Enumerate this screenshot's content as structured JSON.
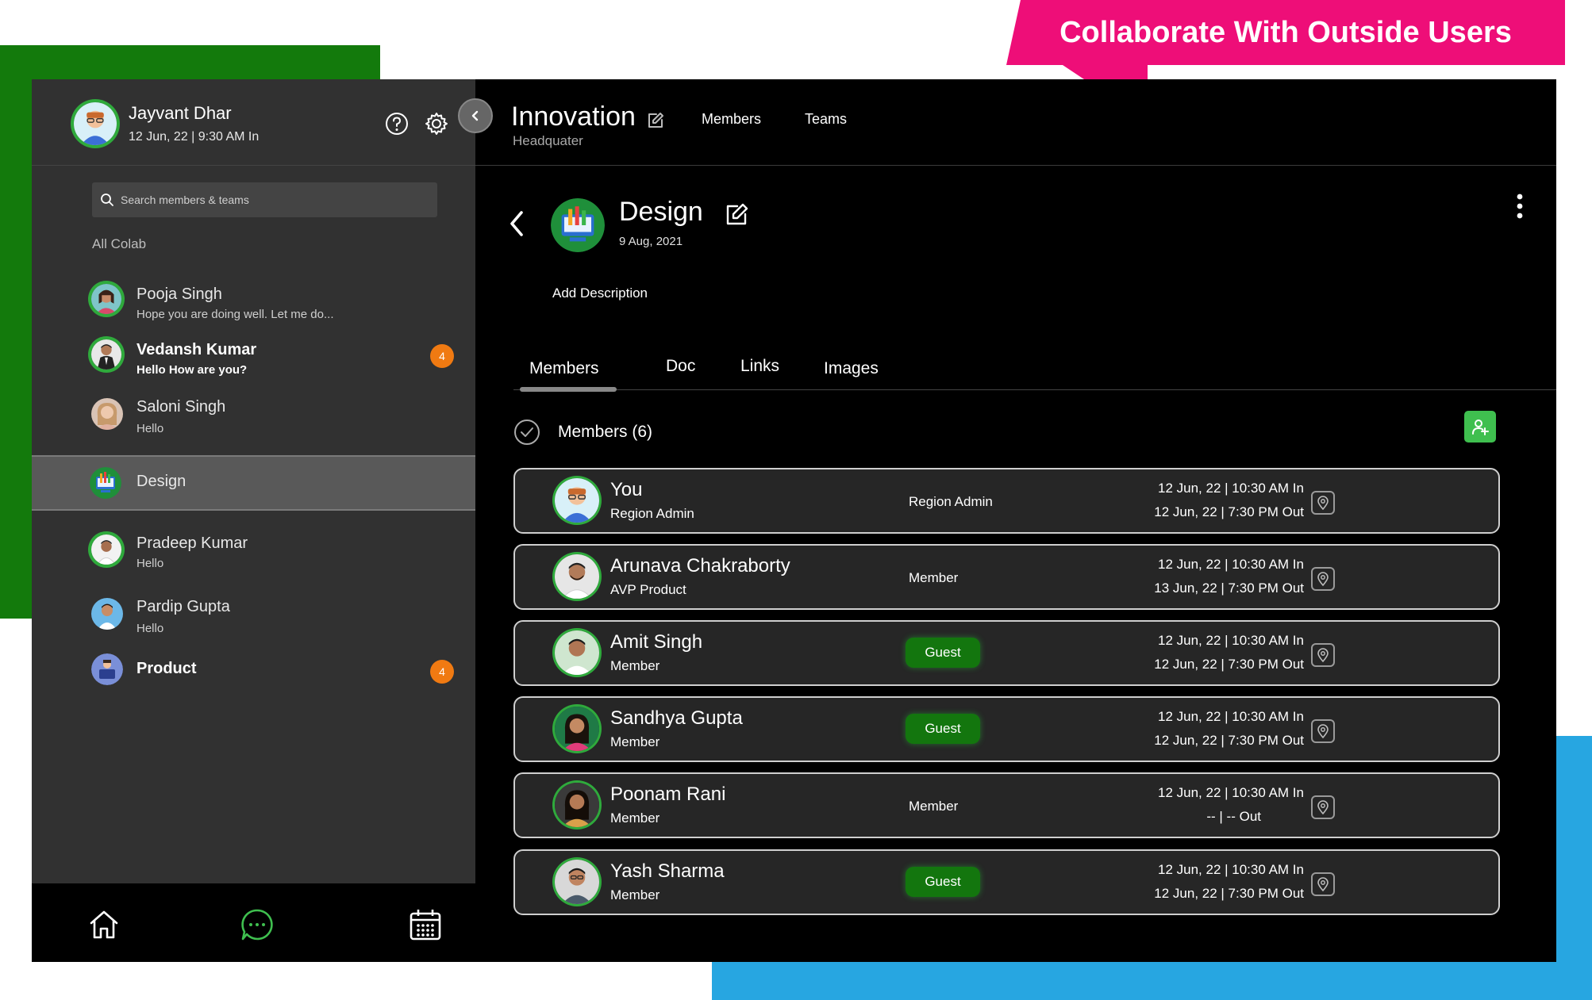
{
  "banner": {
    "text": "Collaborate With Outside Users"
  },
  "colors": {
    "accent_green": "#2faa3c",
    "badge_orange": "#f07a12",
    "guest_green": "#13760e",
    "banner_pink": "#ee0e78"
  },
  "user": {
    "name": "Jayvant Dhar",
    "status": "12 Jun, 22 | 9:30 AM In"
  },
  "search": {
    "placeholder": "Search members & teams"
  },
  "sidebar": {
    "section_label": "All Colab",
    "items": [
      {
        "name": "Pooja Singh",
        "message": "Hope you are doing well. Let me do..."
      },
      {
        "name": "Vedansh Kumar",
        "message": "Hello How are you?",
        "badge": "4"
      },
      {
        "name": "Saloni Singh",
        "message": "Hello"
      },
      {
        "name": "Design",
        "message": ""
      },
      {
        "name": "Pradeep Kumar",
        "message": "Hello"
      },
      {
        "name": "Pardip Gupta",
        "message": "Hello"
      },
      {
        "name": "Product",
        "message": "",
        "badge": "4"
      }
    ]
  },
  "workspace": {
    "title": "Innovation",
    "subtitle": "Headquater",
    "tabs": [
      "Members",
      "Teams"
    ]
  },
  "group": {
    "name": "Design",
    "date": "9 Aug, 2021",
    "add_description": "Add Description"
  },
  "tabs": [
    "Members",
    "Doc",
    "Links",
    "Images"
  ],
  "members_header": "Members (6)",
  "members": [
    {
      "name": "You",
      "role": "Region Admin",
      "status": "Region Admin",
      "guest": false,
      "in": "12 Jun, 22 | 10:30 AM In",
      "out": "12 Jun, 22 | 7:30 PM Out"
    },
    {
      "name": "Arunava Chakraborty",
      "role": "AVP Product",
      "status": "Member",
      "guest": false,
      "in": "12 Jun, 22 | 10:30 AM In",
      "out": "13 Jun, 22 | 7:30 PM Out"
    },
    {
      "name": "Amit Singh",
      "role": "Member",
      "status": "Guest",
      "guest": true,
      "in": "12 Jun, 22 | 10:30 AM In",
      "out": "12 Jun, 22 | 7:30 PM Out"
    },
    {
      "name": "Sandhya Gupta",
      "role": "Member",
      "status": "Guest",
      "guest": true,
      "in": "12 Jun, 22 | 10:30 AM In",
      "out": "12 Jun, 22 | 7:30 PM Out"
    },
    {
      "name": "Poonam Rani",
      "role": "Member",
      "status": "Member",
      "guest": false,
      "in": "12 Jun, 22 | 10:30 AM In",
      "out": "-- | -- Out"
    },
    {
      "name": "Yash Sharma",
      "role": "Member",
      "status": "Guest",
      "guest": true,
      "in": "12 Jun, 22 | 10:30 AM In",
      "out": "12 Jun, 22 | 7:30 PM Out"
    }
  ]
}
